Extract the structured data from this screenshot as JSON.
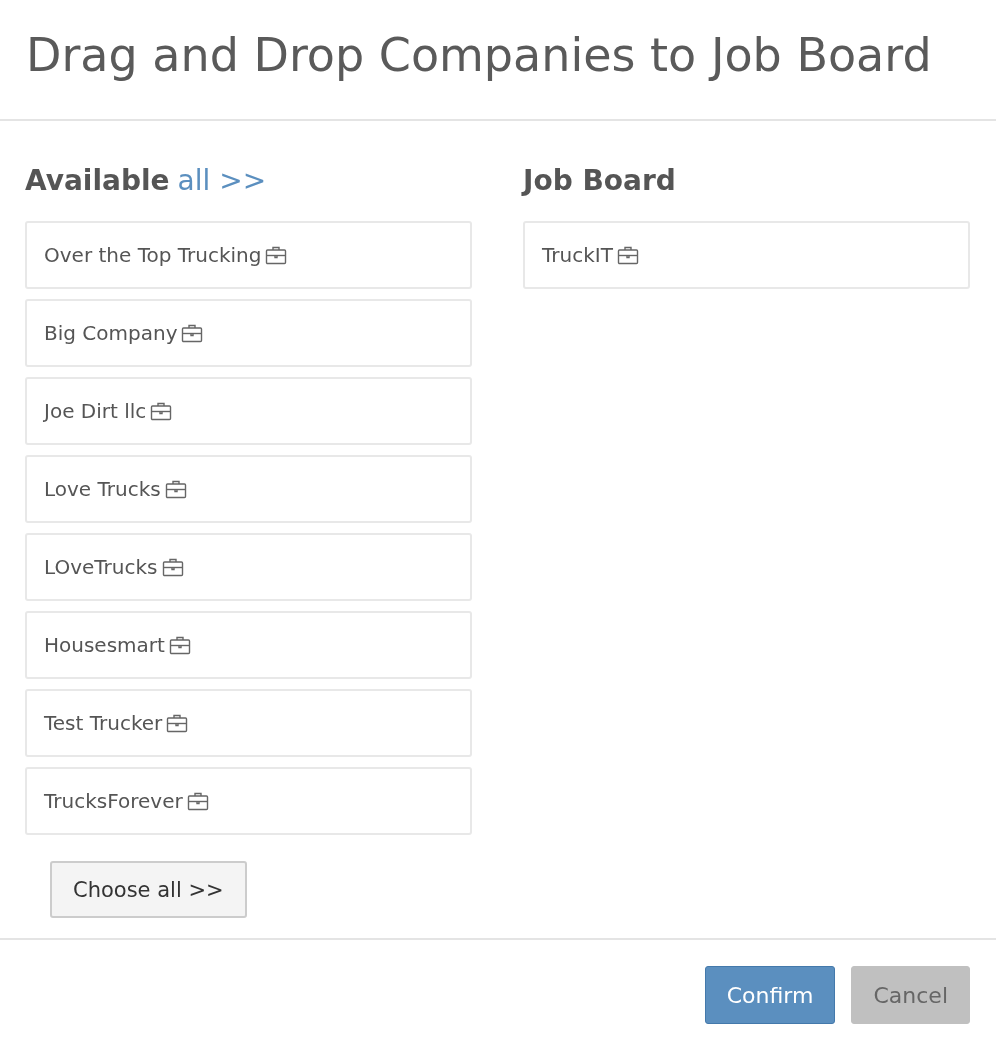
{
  "dialog": {
    "title": "Drag and Drop Companies to Job Board"
  },
  "available": {
    "heading": "Available",
    "link": "all >>",
    "companies": [
      {
        "name": "Over the Top Trucking"
      },
      {
        "name": "Big Company"
      },
      {
        "name": "Joe Dirt llc"
      },
      {
        "name": "Love Trucks"
      },
      {
        "name": "LOveTrucks"
      },
      {
        "name": "Housesmart"
      },
      {
        "name": "Test Trucker"
      },
      {
        "name": "TrucksForever"
      }
    ]
  },
  "job_board": {
    "heading": "Job Board",
    "companies": [
      {
        "name": "TruckIT"
      }
    ]
  },
  "choose_all_button": "Choose all >>",
  "buttons": [
    {
      "label": "Confirm",
      "kind": "primary"
    },
    {
      "label": "Cancel",
      "kind": "secondary"
    }
  ]
}
